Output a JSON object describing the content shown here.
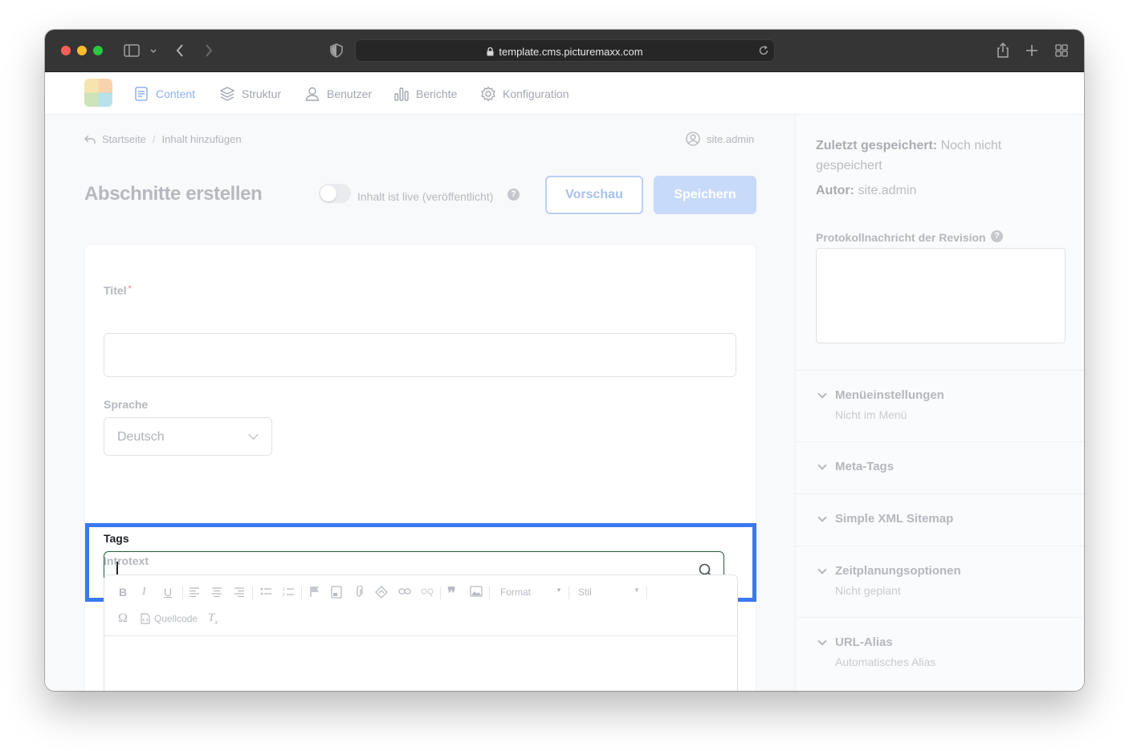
{
  "browser": {
    "url": "template.cms.picturemaxx.com"
  },
  "nav": {
    "items": [
      {
        "label": "Content",
        "icon": "document-icon",
        "active": true
      },
      {
        "label": "Struktur",
        "icon": "layers-icon"
      },
      {
        "label": "Benutzer",
        "icon": "user-icon"
      },
      {
        "label": "Berichte",
        "icon": "bar-chart-icon"
      },
      {
        "label": "Konfiguration",
        "icon": "gear-icon"
      }
    ]
  },
  "breadcrumb": {
    "home": "Startseite",
    "separator": "/",
    "current": "Inhalt hinzufügen"
  },
  "user": {
    "name": "site.admin"
  },
  "page": {
    "title": "Abschnitte erstellen",
    "live_label": "Inhalt ist live (veröffentlicht)",
    "help": "?",
    "preview_button": "Vorschau",
    "save_button": "Speichern"
  },
  "form": {
    "title_label": "Titel",
    "required_mark": "*",
    "language_label": "Sprache",
    "language_value": "Deutsch",
    "tags_label": "Tags",
    "tags_value": "",
    "introtext_label": "Introtext",
    "editor": {
      "format_label": "Format",
      "style_label": "Stil",
      "source_label": "Quellcode"
    }
  },
  "sidebar": {
    "saved_label": "Zuletzt gespeichert:",
    "saved_value": "Noch nicht gespeichert",
    "author_label": "Autor:",
    "author_value": "site.admin",
    "revision_label": "Protokollnachricht der Revision",
    "help": "?",
    "sections": [
      {
        "title": "Menüeinstellungen",
        "subtitle": "Nicht im Menü"
      },
      {
        "title": "Meta-Tags",
        "subtitle": ""
      },
      {
        "title": "Simple XML Sitemap",
        "subtitle": ""
      },
      {
        "title": "Zeitplanungsoptionen",
        "subtitle": "Nicht geplant"
      },
      {
        "title": "URL-Alias",
        "subtitle": "Automatisches Alias"
      }
    ]
  },
  "colors": {
    "highlight": "#3b78f1",
    "accent": "#8fb1f0",
    "tags_border": "#1f5f3a"
  }
}
